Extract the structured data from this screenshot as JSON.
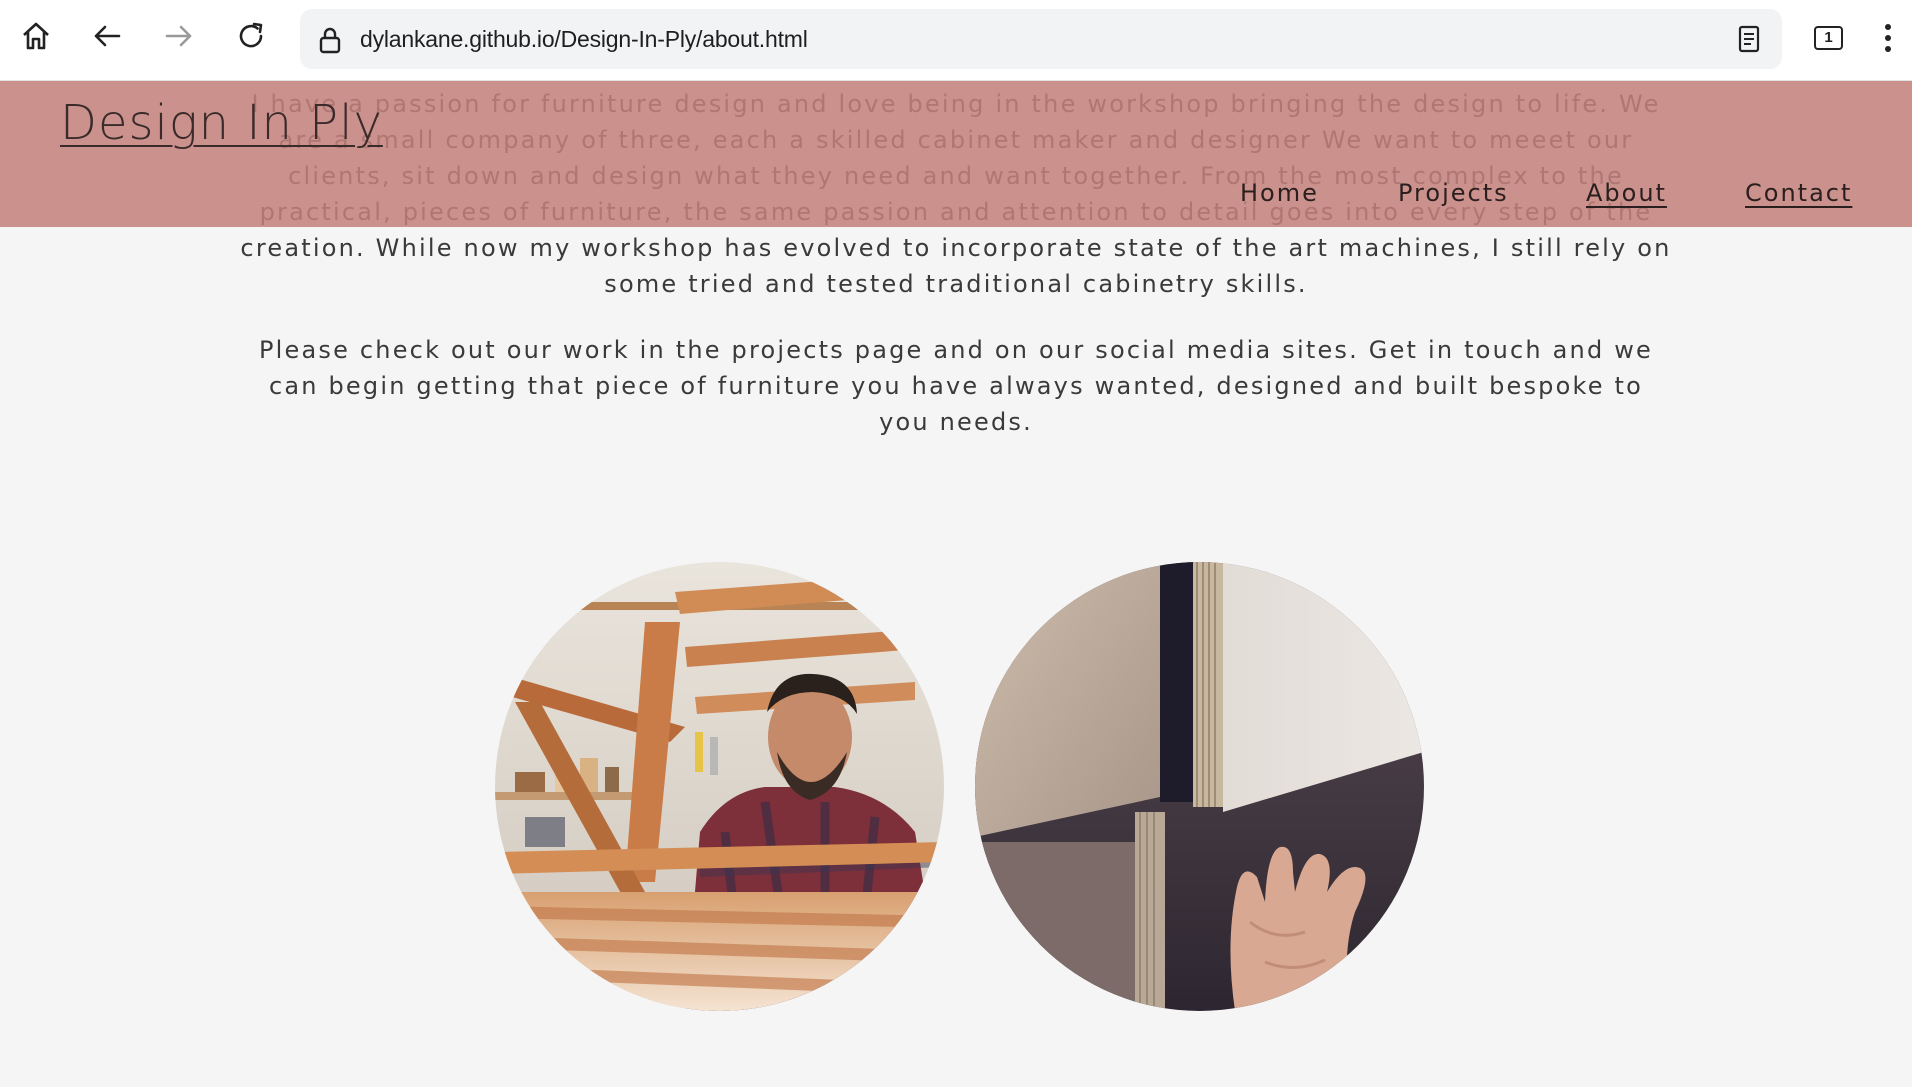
{
  "browser": {
    "url": "dylankane.github.io/Design-In-Ply/about.html",
    "tab_count": "1",
    "icons": [
      "home-icon",
      "back-arrow-icon",
      "forward-arrow-icon",
      "reload-icon",
      "lock-icon",
      "reader-mode-icon",
      "tab-switcher-icon",
      "more-options-icon"
    ]
  },
  "site": {
    "logo": "Design In Ply",
    "nav": {
      "home": "Home",
      "projects": "Projects",
      "about": "About",
      "contact": "Contact"
    },
    "header_color": "#c4807c"
  },
  "about": {
    "paragraph_1": "I have a passion for furniture design and love being in the workshop bringing the design to life. We are a small company of three, each a skilled cabinet maker and designer We want to meeet our clients, sit down and design what they need and want together. From the most complex to the practical, pieces of furniture, the same passion and attention to detail goes into every step of the creation. While now my workshop has evolved to incorporate state of the art machines, I still rely on some tried and tested traditional cabinetry skills.",
    "paragraph_2": "Please check out our work in the projects page and on our social media sites. Get in touch and we can begin getting that piece of furniture you have always wanted, designed and built bespoke to you needs."
  },
  "images": {
    "left": "craftsman-workshop-photo",
    "right": "plywood-edge-hand-photo"
  }
}
